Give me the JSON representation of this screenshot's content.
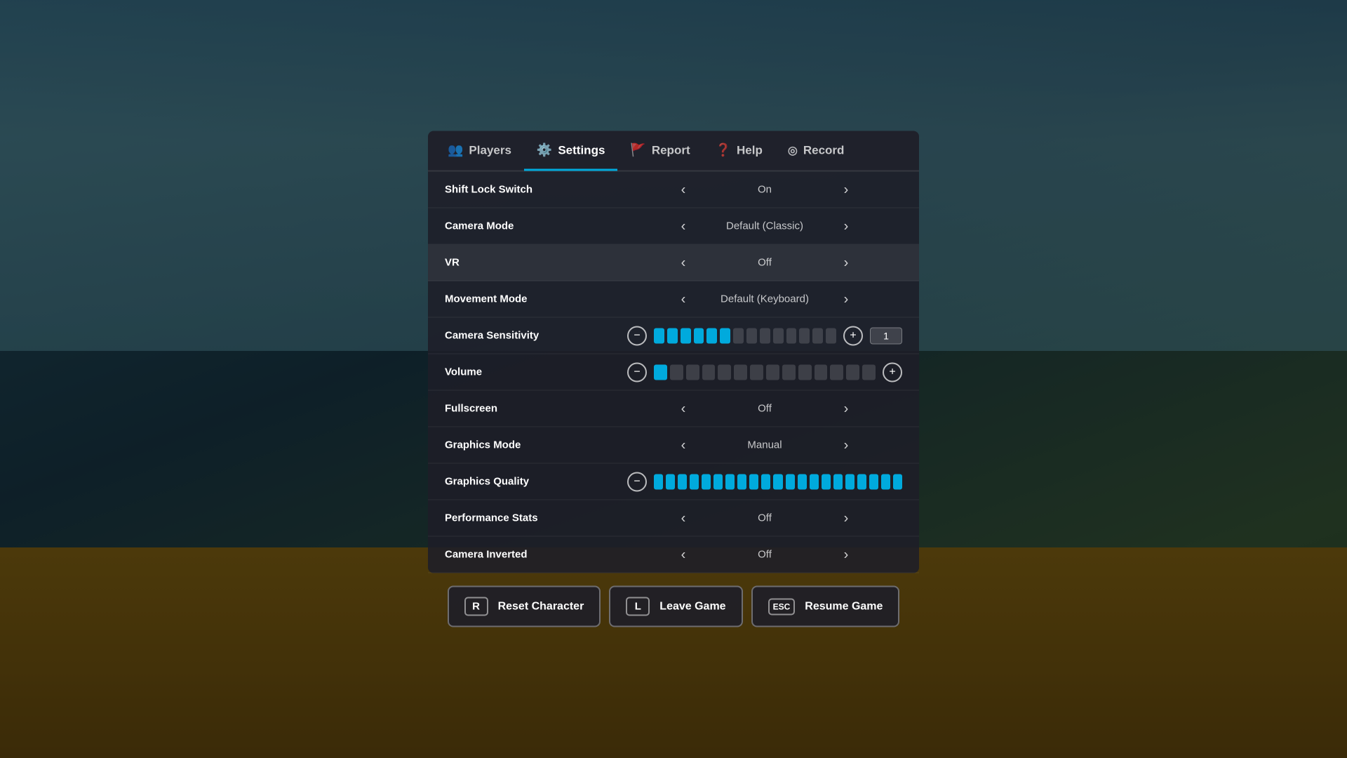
{
  "background": {
    "overlay_opacity": 0.45
  },
  "tabs": [
    {
      "id": "players",
      "label": "Players",
      "icon": "👥",
      "active": false
    },
    {
      "id": "settings",
      "label": "Settings",
      "icon": "⚙️",
      "active": true
    },
    {
      "id": "report",
      "label": "Report",
      "icon": "🚩",
      "active": false
    },
    {
      "id": "help",
      "label": "Help",
      "icon": "❓",
      "active": false
    },
    {
      "id": "record",
      "label": "Record",
      "icon": "⊙",
      "active": false
    }
  ],
  "settings": [
    {
      "id": "shift-lock-switch",
      "label": "Shift Lock Switch",
      "type": "toggle",
      "value": "On",
      "highlighted": false
    },
    {
      "id": "camera-mode",
      "label": "Camera Mode",
      "type": "toggle",
      "value": "Default (Classic)",
      "highlighted": false
    },
    {
      "id": "vr",
      "label": "VR",
      "type": "toggle",
      "value": "Off",
      "highlighted": true
    },
    {
      "id": "movement-mode",
      "label": "Movement Mode",
      "type": "toggle",
      "value": "Default (Keyboard)",
      "highlighted": false
    },
    {
      "id": "camera-sensitivity",
      "label": "Camera Sensitivity",
      "type": "slider",
      "segments": 14,
      "filled": 6,
      "input_value": "1",
      "highlighted": false
    },
    {
      "id": "volume",
      "label": "Volume",
      "type": "slider",
      "segments": 14,
      "filled": 1,
      "input_value": null,
      "highlighted": false
    },
    {
      "id": "fullscreen",
      "label": "Fullscreen",
      "type": "toggle",
      "value": "Off",
      "highlighted": false
    },
    {
      "id": "graphics-mode",
      "label": "Graphics Mode",
      "type": "toggle",
      "value": "Manual",
      "highlighted": false
    },
    {
      "id": "graphics-quality",
      "label": "Graphics Quality",
      "type": "slider-only",
      "segments": 21,
      "filled": 21,
      "highlighted": false
    },
    {
      "id": "performance-stats",
      "label": "Performance Stats",
      "type": "toggle",
      "value": "Off",
      "highlighted": false
    },
    {
      "id": "camera-inverted",
      "label": "Camera Inverted",
      "type": "toggle",
      "value": "Off",
      "highlighted": false
    }
  ],
  "buttons": [
    {
      "id": "reset-character",
      "key": "R",
      "label": "Reset Character"
    },
    {
      "id": "leave-game",
      "key": "L",
      "label": "Leave Game"
    },
    {
      "id": "resume-game",
      "key": "ESC",
      "label": "Resume Game"
    }
  ]
}
